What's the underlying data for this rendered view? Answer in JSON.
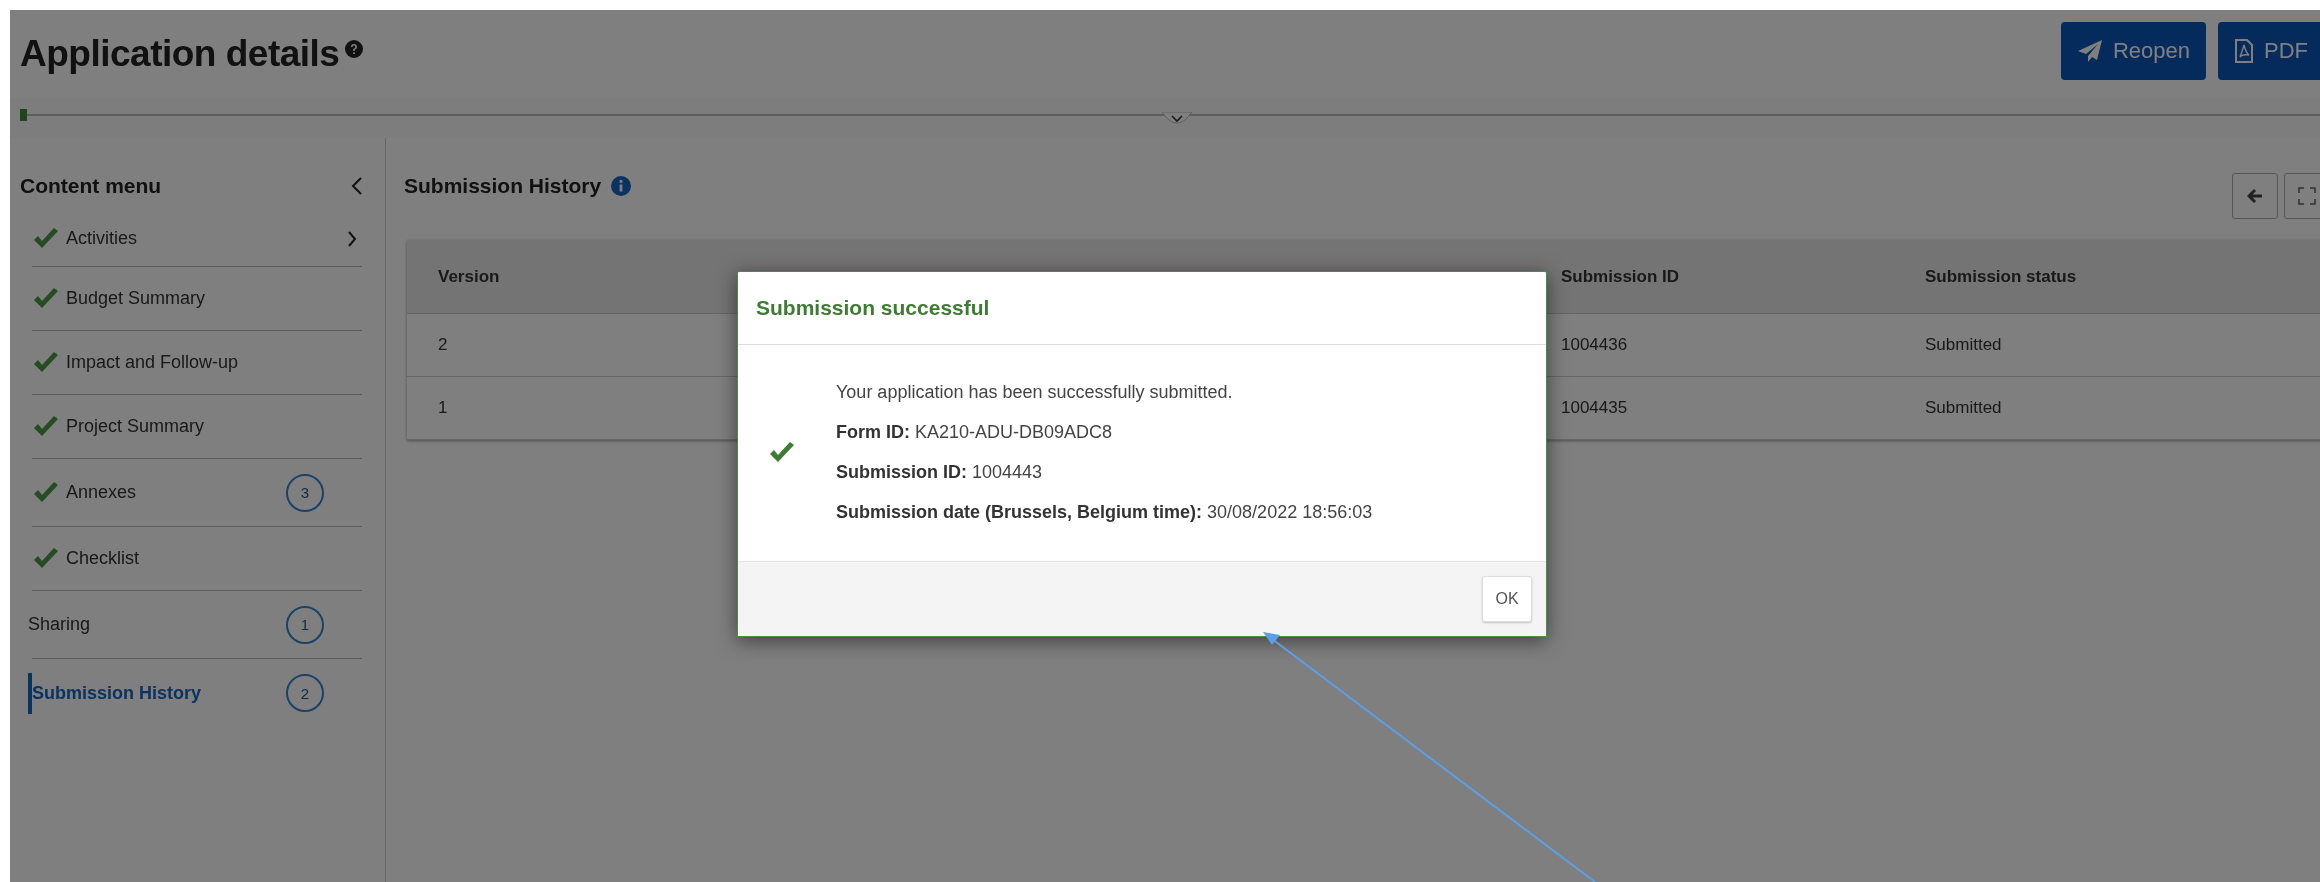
{
  "page": {
    "title": "Application details"
  },
  "header_buttons": [
    {
      "label": "Reopen",
      "kind": "send"
    },
    {
      "label": "PDF",
      "kind": "pdf"
    }
  ],
  "progress": {
    "level": 0.003
  },
  "sidebar": {
    "title": "Content menu",
    "items": [
      {
        "label": "Activities",
        "complete": true,
        "has_children": true,
        "selected": false
      },
      {
        "label": "Budget Summary",
        "complete": true,
        "has_children": false,
        "selected": false
      },
      {
        "label": "Impact and Follow-up",
        "complete": true,
        "has_children": false,
        "selected": false
      },
      {
        "label": "Project Summary",
        "complete": true,
        "has_children": false,
        "selected": false
      },
      {
        "label": "Annexes",
        "complete": true,
        "has_children": false,
        "selected": false,
        "count": "3"
      },
      {
        "label": "Checklist",
        "complete": true,
        "has_children": false,
        "selected": false
      },
      {
        "label": "Sharing",
        "complete": false,
        "has_children": false,
        "selected": false,
        "count": "1"
      },
      {
        "label": "Submission History",
        "complete": false,
        "has_children": false,
        "selected": true,
        "count": "2"
      }
    ]
  },
  "panel": {
    "title": "Submission History",
    "table": {
      "columns": [
        "Version",
        "Submission ID",
        "Submission status"
      ],
      "rows": [
        {
          "version": "2",
          "submission_id": "1004436",
          "status": "Submitted"
        },
        {
          "version": "1",
          "submission_id": "1004435",
          "status": "Submitted"
        }
      ]
    }
  },
  "dialog": {
    "title": "Submission successful",
    "message": "Your application has been successfully submitted.",
    "fields": [
      {
        "label": "Form ID:",
        "value": "KA210-ADU-DB09ADC8"
      },
      {
        "label": "Submission ID:",
        "value": "1004443"
      },
      {
        "label": "Submission date (Brussels, Belgium time):",
        "value": "30/08/2022 18:56:03"
      }
    ],
    "button": "OK"
  }
}
